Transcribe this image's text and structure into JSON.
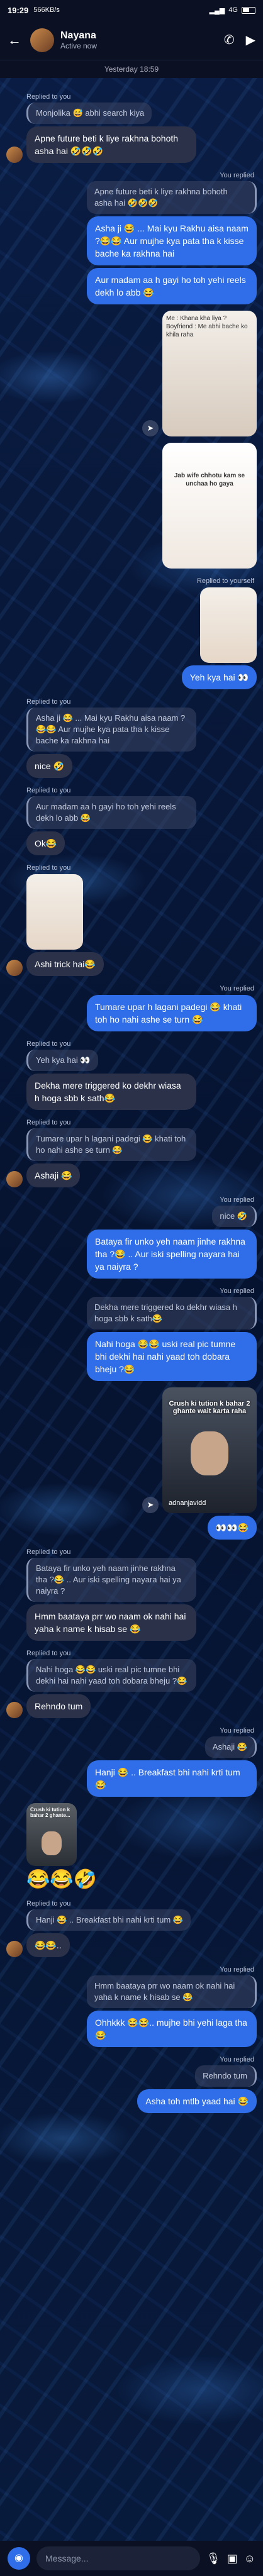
{
  "status": {
    "time": "19:29",
    "speed": "566KB/s",
    "net": "4G"
  },
  "header": {
    "name": "Nayana",
    "status": "Active now"
  },
  "date_label": "Yesterday 18:59",
  "msgs": {
    "m1_label": "Replied to you",
    "m1_quote": "Monjolika 😅 abhi search kiya",
    "m1_text": "Apne future beti k liye rakhna bohoth asha hai 🤣🤣🤣",
    "m2_label": "You replied",
    "m2_quote": "Apne future beti k liye rakhna bohoth asha hai 🤣🤣🤣",
    "m2_text": "Asha ji 😂 ... Mai kyu Rakhu aisa naam ?😂😂 Aur mujhe kya pata tha k kisse bache ka rakhna hai",
    "m3_text": "Aur madam aa h gayi ho toh yehi reels dekh lo abb 😂",
    "reel_caption": "Me : Khana kha liya ? Boyfriend : Me abhi bache ko khila raha",
    "meme_caption": "Jab wife chhotu kam se unchaa ho gaya",
    "reply_self_label": "Replied to yourself",
    "yes_text": "Yeh kya hai 👀",
    "m4_label": "Replied to you",
    "m4_quote": "Asha ji 😂 ... Mai kyu Rakhu aisa naam ? 😂😂 Aur mujhe kya pata tha k kisse bache ka rakhna hai",
    "m4_text": "nice 🤣",
    "m5_label": "Replied to you",
    "m5_quote": "Aur madam aa h gayi ho toh yehi reels dekh lo abb 😂",
    "m5_text": "Ok😂",
    "m6_label": "Replied to you",
    "m6_text": "Ashi trick hai😂",
    "m7_label": "You replied",
    "m7_text": "Tumare upar h lagani padegi 😂 khati toh ho nahi ashe se turn 😂",
    "m8_label": "Replied to you",
    "m8_quote": "Yeh kya hai 👀",
    "m8_text": "Dekha mere triggered ko dekhr wiasa h hoga sbb k sath😂",
    "m9_label": "Replied to you",
    "m9_quote": "Tumare upar h lagani padegi 😂 khati toh ho nahi ashe se turn 😂",
    "m9_text": "Ashaji 😂",
    "m10_label": "You replied",
    "m10_quote": "nice 🤣",
    "m10_text": "Bataya fir unko yeh naam jinhe rakhna tha ?😂 .. Aur iski spelling nayara hai ya naiyra ?",
    "m11_label": "You replied",
    "m11_quote": "Dekha mere triggered ko dekhr wiasa h hoga sbb k sath😂",
    "m11_text": "Nahi hoga 😂😂 uski real pic tumne bhi dekhi hai nahi yaad toh dobara bheju ?😂",
    "vid_caption": "Crush ki tution k bahar 2 ghante wait karta raha",
    "vid_user": "adnanjavidd",
    "vid_reply": "👀👀😂",
    "m12_label": "Replied to you",
    "m12_quote": "Bataya fir unko yeh naam jinhe rakhna tha ?😂 .. Aur iski spelling nayara hai ya naiyra ?",
    "m12_text": "Hmm baataya prr wo naam ok nahi hai yaha k name k hisab se 😂",
    "m13_label": "Replied to you",
    "m13_quote": "Nahi hoga 😂😂 uski real pic tumne bhi dekhi hai nahi yaad toh dobara bheju ?😂",
    "m13_text": "Rehndo tum",
    "m14_label": "You replied",
    "m14_quote": "Ashaji 😂",
    "m14_text": "Hanji 😂 .. Breakfast bhi nahi krti tum 😂",
    "vsmall_caption": "Crush ki tution k bahar 2 ghante...",
    "emojis": "😂😂🤣",
    "m15_label": "Replied to you",
    "m15_quote": "Hanji 😂 .. Breakfast bhi nahi krti tum 😂",
    "m15_text": "😂😂..",
    "m16_label": "You replied",
    "m16_quote": "Hmm baataya prr wo naam ok nahi hai yaha k name k hisab se 😂",
    "m16_text": "Ohhkkk 😂😂.. mujhe bhi yehi laga tha 😂",
    "m17_label": "You replied",
    "m17_quote": "Rehndo tum",
    "m17_text": "Asha toh mtlb yaad hai 😂"
  },
  "input": {
    "placeholder": "Message..."
  },
  "colors": {
    "sent": "#2f6ee8",
    "received": "#2a3149",
    "background": "#071634"
  }
}
